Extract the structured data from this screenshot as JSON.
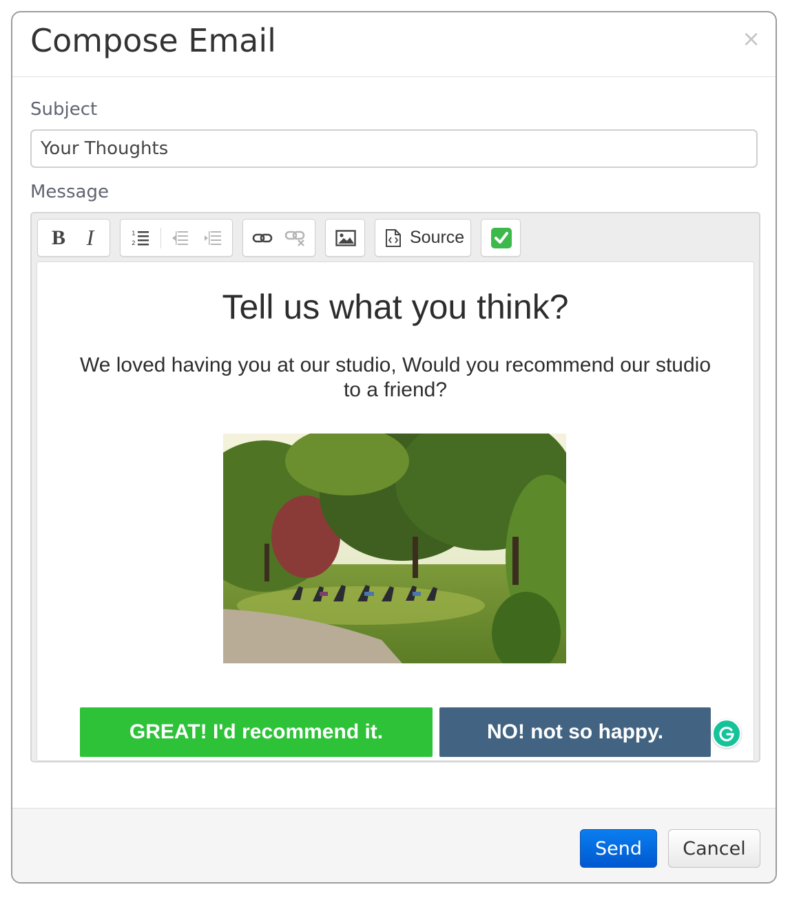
{
  "modal": {
    "title": "Compose Email",
    "close_glyph": "×"
  },
  "subject": {
    "label": "Subject",
    "value": "Your Thoughts"
  },
  "message": {
    "label": "Message"
  },
  "toolbar": {
    "groups": [
      [
        "bold-icon",
        "italic-icon"
      ],
      [
        "numbered-list-icon",
        "decrease-indent-icon",
        "increase-indent-icon"
      ],
      [
        "link-icon",
        "unlink-icon"
      ],
      [
        "image-icon"
      ],
      [
        "source-icon"
      ],
      [
        "checkmark-icon"
      ]
    ],
    "bold_glyph": "B",
    "italic_glyph": "I",
    "source_label": "Source"
  },
  "email": {
    "heading": "Tell us what you think?",
    "body_line1": "We loved having you at our studio, Would you recommend our studio",
    "body_line2": "to a friend?",
    "image_description_icon": "park-yoga-photo",
    "cta_yes": "GREAT! I'd recommend it.",
    "cta_no": "NO! not so happy."
  },
  "footer": {
    "send_label": "Send",
    "cancel_label": "Cancel"
  },
  "colors": {
    "cta_yes": "#2ec239",
    "cta_no": "#426482",
    "send_button": "#0a7ef0",
    "grammarly": "#15c39a",
    "check_green": "#3db94c"
  }
}
